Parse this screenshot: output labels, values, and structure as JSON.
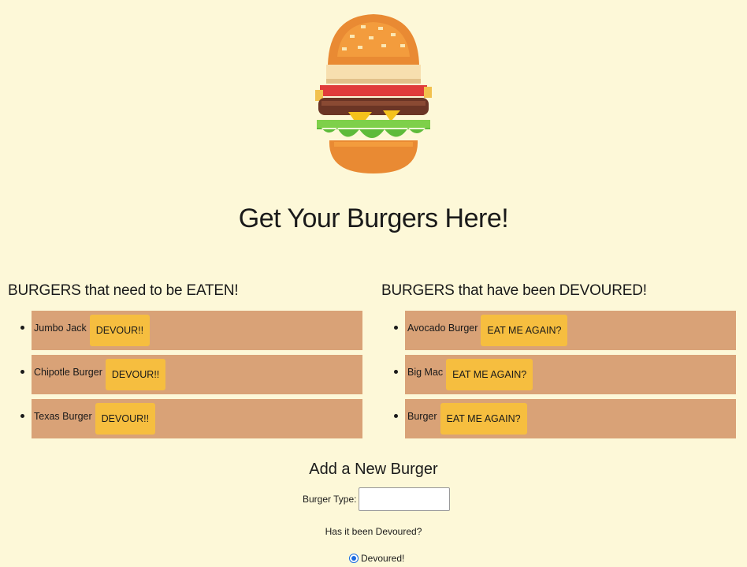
{
  "header": {
    "title": "Get Your Burgers Here!"
  },
  "to_eat": {
    "heading": "BURGERS that need to be EATEN!",
    "items": [
      {
        "name": "Jumbo Jack",
        "button": "DEVOUR!!"
      },
      {
        "name": "Chipotle Burger",
        "button": "DEVOUR!!"
      },
      {
        "name": "Texas Burger",
        "button": "DEVOUR!!"
      }
    ]
  },
  "devoured": {
    "heading": "BURGERS that have been DEVOURED!",
    "items": [
      {
        "name": "Avocado Burger",
        "button": "EAT ME AGAIN?"
      },
      {
        "name": "Big Mac",
        "button": "EAT ME AGAIN?"
      },
      {
        "name": "Burger",
        "button": "EAT ME AGAIN?"
      }
    ]
  },
  "form": {
    "title": "Add a New Burger",
    "type_label": "Burger Type:",
    "type_value": "",
    "question": "Has it been Devoured?",
    "radio_label": "Devoured!"
  },
  "colors": {
    "background": "#fdf8d8",
    "row": "#d9a277",
    "button": "#f6be3f"
  },
  "icons": {
    "hero": "burger-icon"
  }
}
